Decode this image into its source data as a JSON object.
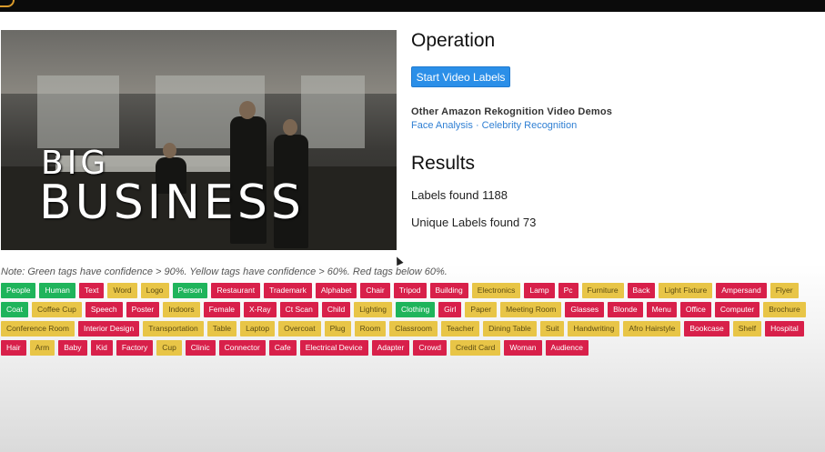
{
  "video": {
    "overlay_line1": "BIG",
    "overlay_line2": "BUSINESS"
  },
  "operation": {
    "title": "Operation",
    "start_button": "Start Video Labels"
  },
  "demos": {
    "title": "Other Amazon Rekognition Video Demos",
    "links": [
      "Face Analysis",
      "Celebrity Recognition"
    ],
    "separator": "·"
  },
  "results": {
    "title": "Results",
    "labels_found": "Labels found 1188",
    "unique_labels": "Unique Labels found 73"
  },
  "note": "Note: Green tags have confidence > 90%. Yellow tags have confidence > 60%. Red tags below 60%.",
  "colors": {
    "green": "#1fb45b",
    "yellow": "#e8c547",
    "red": "#d8204a",
    "button": "#2b8fe8",
    "link": "#2f7fd3"
  },
  "tags": [
    {
      "label": "People",
      "level": "green"
    },
    {
      "label": "Human",
      "level": "green"
    },
    {
      "label": "Text",
      "level": "red"
    },
    {
      "label": "Word",
      "level": "yellow"
    },
    {
      "label": "Logo",
      "level": "yellow"
    },
    {
      "label": "Person",
      "level": "green"
    },
    {
      "label": "Restaurant",
      "level": "red"
    },
    {
      "label": "Trademark",
      "level": "red"
    },
    {
      "label": "Alphabet",
      "level": "red"
    },
    {
      "label": "Chair",
      "level": "red"
    },
    {
      "label": "Tripod",
      "level": "red"
    },
    {
      "label": "Building",
      "level": "red"
    },
    {
      "label": "Electronics",
      "level": "yellow"
    },
    {
      "label": "Lamp",
      "level": "red"
    },
    {
      "label": "Pc",
      "level": "red"
    },
    {
      "label": "Furniture",
      "level": "yellow"
    },
    {
      "label": "Back",
      "level": "red"
    },
    {
      "label": "Light Fixture",
      "level": "yellow"
    },
    {
      "label": "Ampersand",
      "level": "red"
    },
    {
      "label": "Flyer",
      "level": "yellow"
    },
    {
      "label": "Coat",
      "level": "green"
    },
    {
      "label": "Coffee Cup",
      "level": "yellow"
    },
    {
      "label": "Speech",
      "level": "red"
    },
    {
      "label": "Poster",
      "level": "red"
    },
    {
      "label": "Indoors",
      "level": "yellow"
    },
    {
      "label": "Female",
      "level": "red"
    },
    {
      "label": "X-Ray",
      "level": "red"
    },
    {
      "label": "Ct Scan",
      "level": "red"
    },
    {
      "label": "Child",
      "level": "red"
    },
    {
      "label": "Lighting",
      "level": "yellow"
    },
    {
      "label": "Clothing",
      "level": "green"
    },
    {
      "label": "Girl",
      "level": "red"
    },
    {
      "label": "Paper",
      "level": "yellow"
    },
    {
      "label": "Meeting Room",
      "level": "yellow"
    },
    {
      "label": "Glasses",
      "level": "red"
    },
    {
      "label": "Blonde",
      "level": "red"
    },
    {
      "label": "Menu",
      "level": "red"
    },
    {
      "label": "Office",
      "level": "red"
    },
    {
      "label": "Computer",
      "level": "red"
    },
    {
      "label": "Brochure",
      "level": "yellow"
    },
    {
      "label": "Conference Room",
      "level": "yellow"
    },
    {
      "label": "Interior Design",
      "level": "red"
    },
    {
      "label": "Transportation",
      "level": "yellow"
    },
    {
      "label": "Table",
      "level": "yellow"
    },
    {
      "label": "Laptop",
      "level": "yellow"
    },
    {
      "label": "Overcoat",
      "level": "yellow"
    },
    {
      "label": "Plug",
      "level": "yellow"
    },
    {
      "label": "Room",
      "level": "yellow"
    },
    {
      "label": "Classroom",
      "level": "yellow"
    },
    {
      "label": "Teacher",
      "level": "yellow"
    },
    {
      "label": "Dining Table",
      "level": "yellow"
    },
    {
      "label": "Suit",
      "level": "yellow"
    },
    {
      "label": "Handwriting",
      "level": "yellow"
    },
    {
      "label": "Afro Hairstyle",
      "level": "yellow"
    },
    {
      "label": "Bookcase",
      "level": "red"
    },
    {
      "label": "Shelf",
      "level": "yellow"
    },
    {
      "label": "Hospital",
      "level": "red"
    },
    {
      "label": "Hair",
      "level": "red"
    },
    {
      "label": "Arm",
      "level": "yellow"
    },
    {
      "label": "Baby",
      "level": "red"
    },
    {
      "label": "Kid",
      "level": "red"
    },
    {
      "label": "Factory",
      "level": "red"
    },
    {
      "label": "Cup",
      "level": "yellow"
    },
    {
      "label": "Clinic",
      "level": "red"
    },
    {
      "label": "Connector",
      "level": "red"
    },
    {
      "label": "Cafe",
      "level": "red"
    },
    {
      "label": "Electrical Device",
      "level": "red"
    },
    {
      "label": "Adapter",
      "level": "red"
    },
    {
      "label": "Crowd",
      "level": "red"
    },
    {
      "label": "Credit Card",
      "level": "yellow"
    },
    {
      "label": "Woman",
      "level": "red"
    },
    {
      "label": "Audience",
      "level": "red"
    }
  ]
}
